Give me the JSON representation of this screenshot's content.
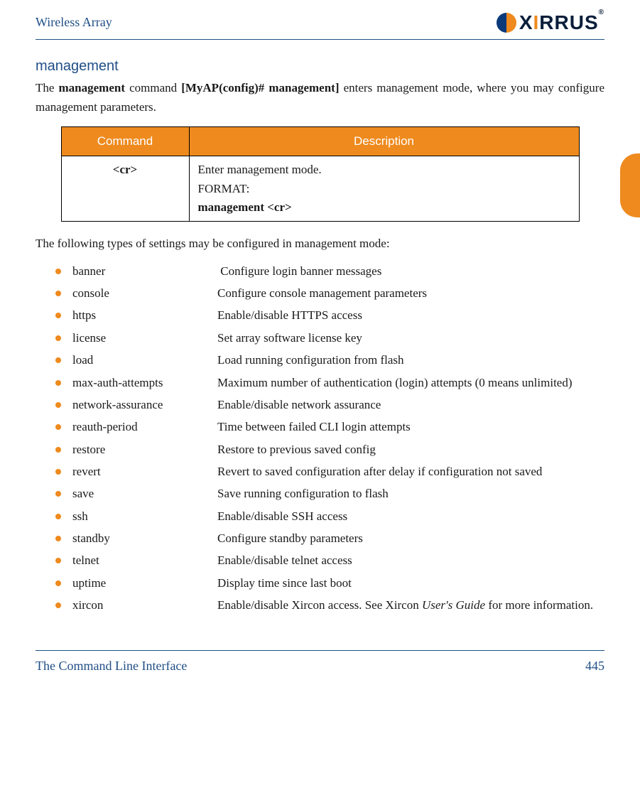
{
  "header": {
    "title": "Wireless Array",
    "brand": {
      "name": "XIRRUS",
      "reg": "®"
    }
  },
  "section": {
    "heading": "management"
  },
  "intro": {
    "t1": "The ",
    "bold1": "management",
    "t2": " command ",
    "bold2": "[MyAP(config)# management]",
    "t3": " enters management mode, where you may configure management parameters."
  },
  "table": {
    "headers": {
      "c1": "Command",
      "c2": "Description"
    },
    "row": {
      "cmd": "<cr>",
      "desc_l1": "Enter management mode.",
      "desc_l2": "FORMAT:",
      "desc_l3": "management <cr>"
    }
  },
  "lead": "The following types of settings may be configured in management mode:",
  "settings": [
    {
      "term": "banner",
      "def": " Configure login banner messages"
    },
    {
      "term": "console",
      "def": "Configure console management parameters"
    },
    {
      "term": "https",
      "def": "Enable/disable HTTPS access"
    },
    {
      "term": "license",
      "def": "Set array software license key"
    },
    {
      "term": "load",
      "def": "Load running configuration from flash"
    },
    {
      "term": "max-auth-attempts",
      "def": "Maximum number of authentication (login) attempts (0 means unlimited)",
      "wraps": true
    },
    {
      "term": "network-assurance",
      "def": "Enable/disable network assurance"
    },
    {
      "term": "reauth-period",
      "def": "Time between failed CLI login attempts"
    },
    {
      "term": "restore",
      "def": "Restore to previous saved config"
    },
    {
      "term": "revert",
      "def": "Revert to saved configuration after delay if configuration not saved",
      "wraps": true
    },
    {
      "term": "save",
      "def": "Save running configuration to flash"
    },
    {
      "term": "ssh",
      "def": "Enable/disable SSH access"
    },
    {
      "term": "standby",
      "def": "Configure standby parameters"
    },
    {
      "term": "telnet",
      "def": "Enable/disable telnet access"
    },
    {
      "term": "uptime",
      "def": "Display time since last boot"
    },
    {
      "term": "xircon",
      "def_pre": "Enable/disable Xircon access. See Xircon ",
      "def_italic": "User's Guide",
      "def_post": " for more information.",
      "rich": true,
      "wraps": true
    }
  ],
  "footer": {
    "left": "The Command Line Interface",
    "right": "445"
  }
}
